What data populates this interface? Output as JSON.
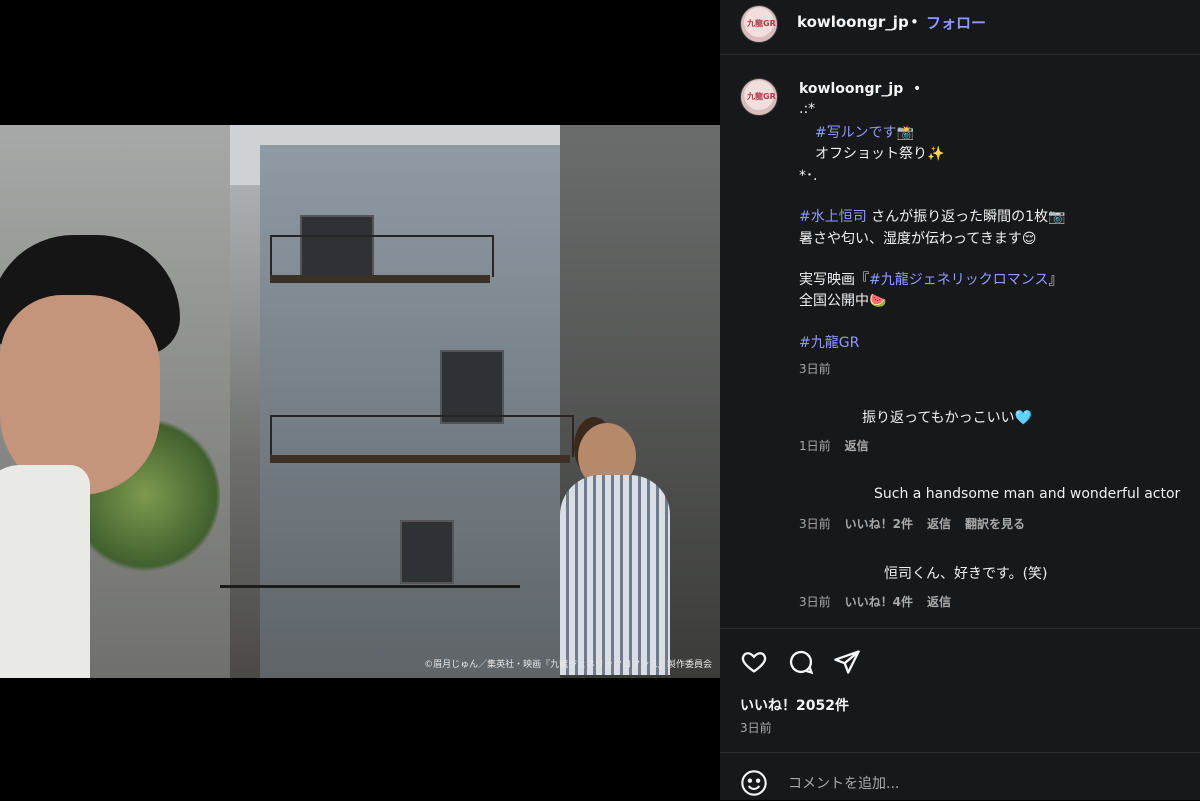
{
  "post": {
    "username": "kowloongr_jp",
    "follow_label": "フォロー",
    "separator": "•",
    "avatar_text": "九龍GR",
    "photo_credit": "©眉月じゅん／集英社・映画『九龍ジェネリックロマンス』製作委員会"
  },
  "caption": {
    "username": "kowloongr_jp",
    "separator": "•",
    "lines": [
      {
        "text": ".:*"
      },
      {
        "tag": "#写ルンです",
        "text": "📸"
      },
      {
        "text": "オフショット祭り✨"
      },
      {
        "text": "*･."
      },
      {
        "tag": "#水上恒司",
        "text": " さんが振り返った瞬間の1枚📷"
      },
      {
        "text": "暑さや匂い、湿度が伝わってきます😌"
      },
      {
        "text": "実写映画『",
        "tag": "#九龍ジェネリックロマンス",
        "text2": "』"
      },
      {
        "text": "全国公開中🍉"
      },
      {
        "tag": "#九龍GR"
      }
    ],
    "time": "3日前"
  },
  "comments": [
    {
      "text": "振り返ってもかっこいい🩵",
      "time": "1日前",
      "reply": "返信"
    },
    {
      "text": "Such a handsome man and wonderful actor",
      "time": "3日前",
      "likes": "いいね！2件",
      "reply": "返信",
      "translate": "翻訳を見る"
    },
    {
      "text": "恒司くん、好きです。(笑)",
      "time": "3日前",
      "likes": "いいね！4件",
      "reply": "返信"
    }
  ],
  "stats": {
    "likes": "いいね！2052件",
    "posted": "3日前"
  },
  "add_comment": {
    "placeholder": "コメントを追加..."
  },
  "icons": [
    "heart-icon",
    "comment-icon",
    "share-icon",
    "emoji-icon"
  ],
  "colors": {
    "link": "#8f9bff",
    "panel_bg": "#17181a",
    "muted": "#a8a8a8"
  }
}
